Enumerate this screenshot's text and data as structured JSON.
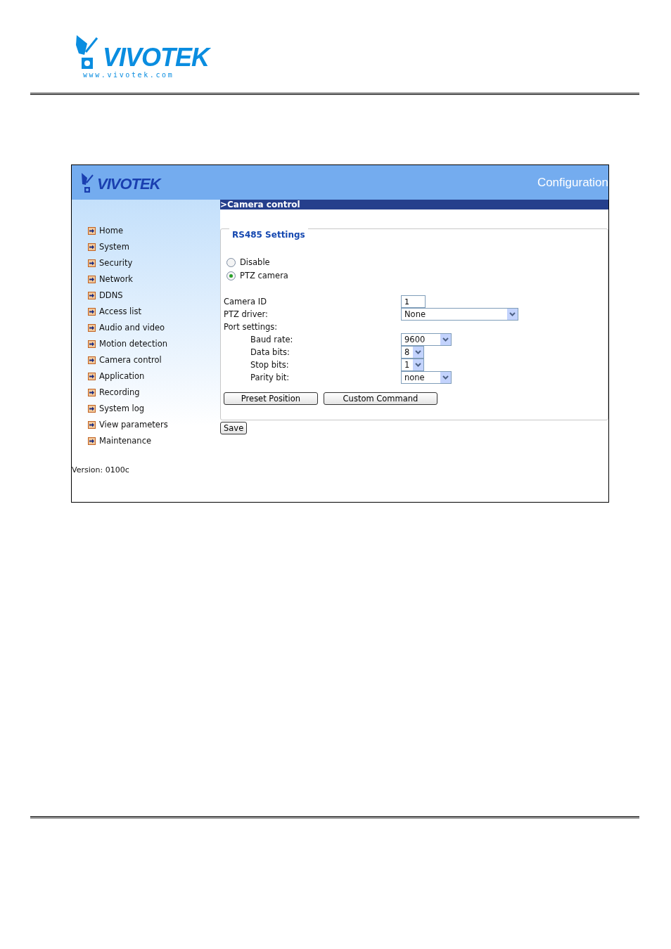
{
  "doc_logo": {
    "name": "VIVOTEK",
    "url": "www.vivotek.com"
  },
  "app": {
    "logo": "VIVOTEK",
    "title": "Configuration",
    "menu": [
      "Home",
      "System",
      "Security",
      "Network",
      "DDNS",
      "Access list",
      "Audio and video",
      "Motion detection",
      "Camera control",
      "Application",
      "Recording",
      "System log",
      "View parameters",
      "Maintenance"
    ],
    "version": "Version: 0100c",
    "section_title": "Camera control",
    "section_marker": ">",
    "fieldset": {
      "legend": "RS485 Settings",
      "radios": [
        {
          "label": "Disable",
          "selected": false
        },
        {
          "label": "PTZ camera",
          "selected": true
        }
      ],
      "fields": [
        {
          "kind": "text",
          "label": "Camera ID",
          "value": "1"
        },
        {
          "kind": "select",
          "label": "PTZ driver:",
          "value": "None"
        },
        {
          "kind": "group",
          "label": "Port settings:",
          "children": [
            {
              "kind": "select",
              "label": "Baud rate:",
              "value": "9600"
            },
            {
              "kind": "select",
              "label": "Data bits:",
              "value": "8"
            },
            {
              "kind": "select",
              "label": "Stop bits:",
              "value": "1"
            },
            {
              "kind": "select",
              "label": "Parity bit:",
              "value": "none"
            }
          ]
        }
      ],
      "buttons": [
        "Preset Position",
        "Custom Command"
      ]
    },
    "save_button": "Save"
  }
}
